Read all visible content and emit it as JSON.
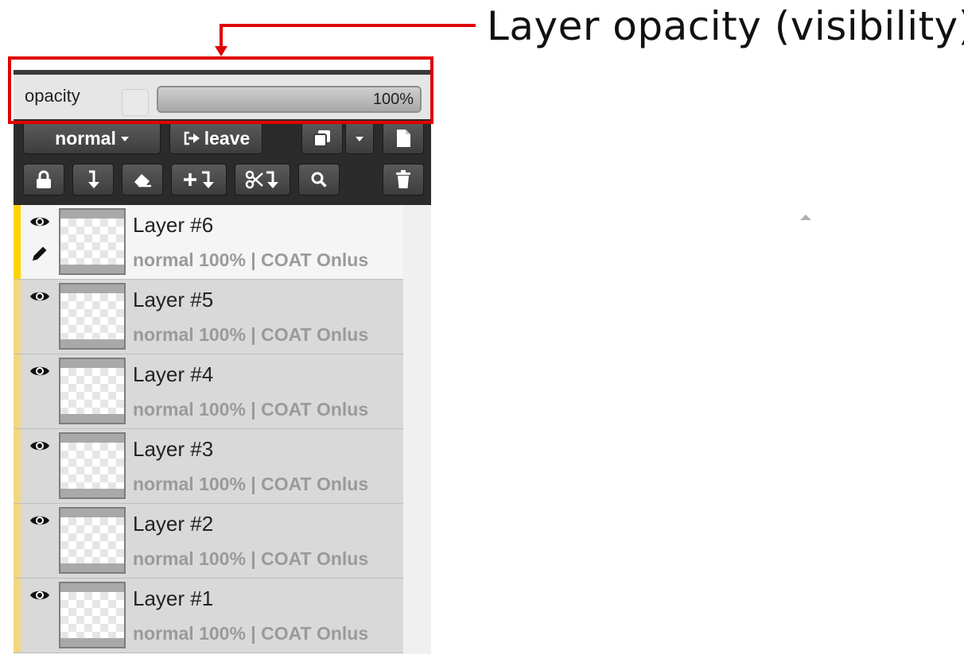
{
  "annotation": {
    "text": "Layer opacity (visibility)"
  },
  "opacity": {
    "label": "opacity",
    "value_text": "100%",
    "value": 100
  },
  "toolbar": {
    "blend_mode_label": "normal",
    "leave_label": "leave"
  },
  "icons": {
    "leave": "leave-icon",
    "duplicate": "duplicate-icon",
    "new_layer": "new-layer-icon",
    "lock": "lock-icon",
    "merge_down": "merge-down-icon",
    "clear": "eraser-icon",
    "add_below": "add-below-icon",
    "cut_below": "cut-below-icon",
    "find": "search-icon",
    "delete": "trash-icon",
    "visibility": "eye-icon",
    "editing": "pencil-icon"
  },
  "colors": {
    "annotation": "#e00000",
    "active_stripe": "#ffd400",
    "stripe": "#f2d780"
  },
  "layers": [
    {
      "name": "Layer #6",
      "meta": "normal 100% | COAT Onlus",
      "active": true
    },
    {
      "name": "Layer #5",
      "meta": "normal 100% | COAT Onlus",
      "active": false
    },
    {
      "name": "Layer #4",
      "meta": "normal 100% | COAT Onlus",
      "active": false
    },
    {
      "name": "Layer #3",
      "meta": "normal 100% | COAT Onlus",
      "active": false
    },
    {
      "name": "Layer #2",
      "meta": "normal 100% | COAT Onlus",
      "active": false
    },
    {
      "name": "Layer #1",
      "meta": "normal 100% | COAT Onlus",
      "active": false
    }
  ]
}
